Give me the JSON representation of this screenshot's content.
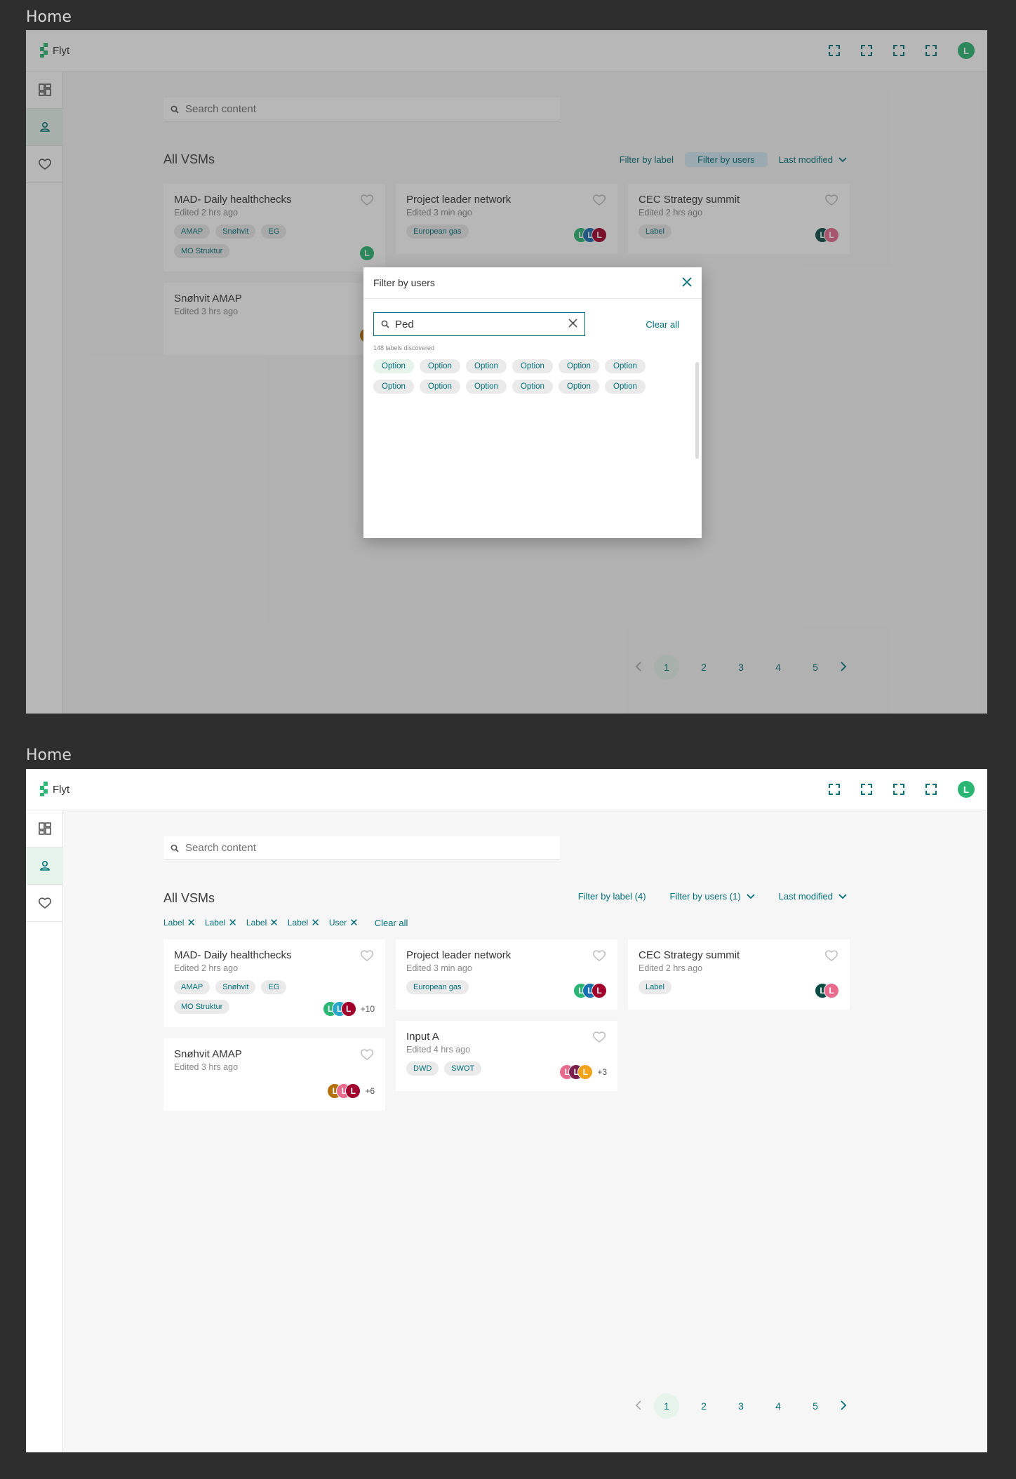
{
  "frames": [
    {
      "title": "Home"
    },
    {
      "title": "Home"
    }
  ],
  "app": {
    "name": "Flyt"
  },
  "search": {
    "placeholder": "Search content"
  },
  "section_title": "All VSMs",
  "frame1_filters": {
    "label": "Filter by label",
    "users": "Filter by users",
    "sort": "Last modified"
  },
  "frame2_filters": {
    "label": "Filter by label (4)",
    "users": "Filter by users (1)",
    "sort": "Last modified"
  },
  "active_chips": [
    "Label",
    "Label",
    "Label",
    "Label",
    "User"
  ],
  "clear_all": "Clear all",
  "cards1": [
    {
      "title": "MAD- Daily healthchecks",
      "sub": "Edited 2 hrs ago",
      "tags": [
        "AMAP",
        "Snøhvit",
        "EG",
        "MO Struktur"
      ]
    },
    {
      "title": "Project leader network",
      "sub": "Edited 3 min ago",
      "tags": [
        "European gas"
      ]
    },
    {
      "title": "CEC Strategy summit",
      "sub": "Edited 2 hrs ago",
      "tags": [
        "Label"
      ]
    },
    {
      "title": "Snøhvit AMAP",
      "sub": "Edited 3 hrs ago",
      "tags": []
    }
  ],
  "cards2": [
    {
      "title": "MAD- Daily healthchecks",
      "sub": "Edited 2 hrs ago",
      "tags": [
        "AMAP",
        "Snøhvit",
        "EG",
        "MO Struktur"
      ],
      "more": "+10"
    },
    {
      "title": "Project leader network",
      "sub": "Edited 3 min ago",
      "tags": [
        "European gas"
      ],
      "more": ""
    },
    {
      "title": "CEC Strategy summit",
      "sub": "Edited 2 hrs ago",
      "tags": [
        "Label"
      ],
      "more": ""
    },
    {
      "title": "Snøhvit AMAP",
      "sub": "Edited 3 hrs ago",
      "tags": [],
      "more": "+6"
    },
    {
      "title": "Input A",
      "sub": "Edited 4 hrs ago",
      "tags": [
        "DWD",
        "SWOT"
      ],
      "more": "+3"
    }
  ],
  "avatar_letter": "L",
  "pager": {
    "pages": [
      "1",
      "2",
      "3",
      "4",
      "5"
    ],
    "current": "1"
  },
  "modal": {
    "title": "Filter by users",
    "query": "Ped",
    "clear_all": "Clear all",
    "count": "148 labels discovered",
    "options": [
      "Option",
      "Option",
      "Option",
      "Option",
      "Option",
      "Option",
      "Option",
      "Option",
      "Option",
      "Option",
      "Option",
      "Option"
    ]
  },
  "colors": {
    "accent": "#007079",
    "green": "#2bb673"
  }
}
